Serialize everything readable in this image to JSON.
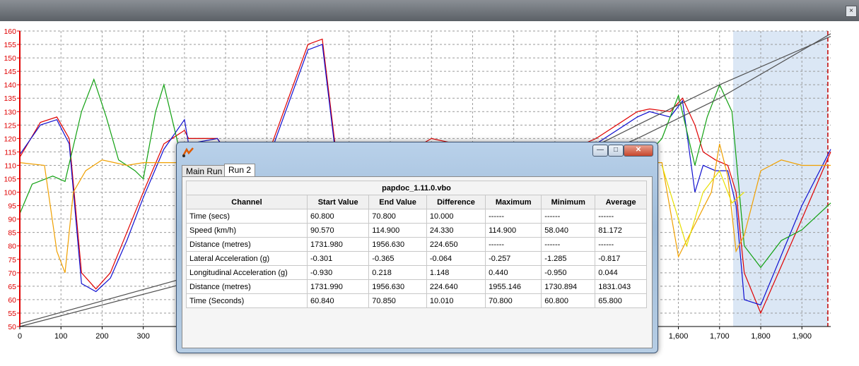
{
  "window": {
    "title_icon": "dataplot-icon",
    "buttons": {
      "minimize": "—",
      "maximize": "□",
      "close": "✕"
    },
    "close_top": "×"
  },
  "tabs": [
    {
      "label": "Main Run",
      "active": false
    },
    {
      "label": "Run 2",
      "active": true
    }
  ],
  "table": {
    "title": "papdoc_1.11.0.vbo",
    "headers": [
      "Channel",
      "Start Value",
      "End Value",
      "Difference",
      "Maximum",
      "Minimum",
      "Average"
    ],
    "rows": [
      [
        "Time (secs)",
        "60.800",
        "70.800",
        "10.000",
        "------",
        "------",
        "------"
      ],
      [
        "Speed (km/h)",
        "90.570",
        "114.900",
        "24.330",
        "114.900",
        "58.040",
        "81.172"
      ],
      [
        "Distance (metres)",
        "1731.980",
        "1956.630",
        "224.650",
        "------",
        "------",
        "------"
      ],
      [
        "Lateral Acceleration (g)",
        "-0.301",
        "-0.365",
        "-0.064",
        "-0.257",
        "-1.285",
        "-0.817"
      ],
      [
        "Longitudinal Acceleration (g)",
        "-0.930",
        "0.218",
        "1.148",
        "0.440",
        "-0.950",
        "0.044"
      ],
      [
        "Distance (metres)",
        "1731.990",
        "1956.630",
        "224.640",
        "1955.146",
        "1730.894",
        "1831.043"
      ],
      [
        "Time (Seconds)",
        "60.840",
        "70.850",
        "10.010",
        "70.800",
        "60.800",
        "65.800"
      ]
    ]
  },
  "chart_data": {
    "type": "line",
    "xlim": [
      0,
      1970
    ],
    "ylim": [
      50,
      160
    ],
    "x_ticks": [
      "0",
      "100",
      "200",
      "300",
      "1,600",
      "1,700",
      "1,800",
      "1,900"
    ],
    "x_tick_values": [
      0,
      100,
      200,
      300,
      1600,
      1700,
      1800,
      1900
    ],
    "y_ticks": [
      "50",
      "55",
      "60",
      "65",
      "70",
      "75",
      "80",
      "85",
      "90",
      "95",
      "100",
      "105",
      "110",
      "115",
      "120",
      "125",
      "130",
      "135",
      "140",
      "145",
      "150",
      "155",
      "160"
    ],
    "grid": true,
    "selection_x": [
      1733,
      1963
    ],
    "colors": {
      "red": "#e00000",
      "blue": "#1010d0",
      "green": "#10a010",
      "orange": "#f0a000",
      "yellow": "#e8e000",
      "gray": "#505050",
      "axis": "#e00000",
      "selection": "#dbe7f5"
    },
    "series": [
      {
        "color": "#e00000",
        "x": [
          0,
          50,
          90,
          120,
          150,
          185,
          220,
          260,
          300,
          350,
          400,
          410,
          480,
          570,
          700,
          735,
          780,
          1000,
          1150,
          1250,
          1400,
          1500,
          1530,
          1580,
          1610,
          1640,
          1660,
          1690,
          1720,
          1740,
          1760,
          1800,
          1900,
          1970
        ],
        "y": [
          113,
          126,
          128,
          120,
          70,
          64,
          70,
          85,
          100,
          118,
          123,
          120,
          120,
          100,
          155,
          157,
          100,
          120,
          115,
          110,
          120,
          130,
          131,
          130,
          135,
          125,
          115,
          112,
          110,
          100,
          70,
          55,
          90,
          115
        ]
      },
      {
        "color": "#1010d0",
        "x": [
          0,
          50,
          90,
          120,
          150,
          185,
          220,
          260,
          300,
          350,
          400,
          410,
          480,
          570,
          700,
          735,
          780,
          1000,
          1150,
          1250,
          1400,
          1500,
          1530,
          1580,
          1610,
          1640,
          1660,
          1690,
          1720,
          1740,
          1760,
          1800,
          1900,
          1970
        ],
        "y": [
          114,
          125,
          127,
          118,
          66,
          63,
          68,
          82,
          98,
          116,
          127,
          118,
          120,
          98,
          153,
          155,
          98,
          118,
          113,
          108,
          118,
          128,
          130,
          128,
          134,
          100,
          110,
          108,
          108,
          95,
          60,
          58,
          95,
          116
        ]
      },
      {
        "color": "#10a010",
        "x": [
          0,
          30,
          80,
          110,
          150,
          180,
          210,
          240,
          280,
          300,
          330,
          350,
          400,
          450,
          1000,
          1500,
          1560,
          1600,
          1640,
          1670,
          1700,
          1730,
          1760,
          1800,
          1850,
          1900,
          1970
        ],
        "y": [
          92,
          103,
          106,
          104,
          130,
          142,
          128,
          112,
          108,
          105,
          130,
          140,
          108,
          110,
          112,
          110,
          120,
          136,
          110,
          128,
          140,
          130,
          80,
          72,
          82,
          86,
          96
        ]
      },
      {
        "color": "#f0a000",
        "x": [
          0,
          60,
          90,
          110,
          130,
          160,
          200,
          260,
          300,
          350,
          400,
          1560,
          1600,
          1620,
          1680,
          1700,
          1720,
          1740,
          1760,
          1800,
          1850,
          1900,
          1970
        ],
        "y": [
          111,
          110,
          78,
          70,
          100,
          108,
          112,
          110,
          111,
          111,
          111,
          111,
          76,
          82,
          100,
          118,
          106,
          78,
          84,
          108,
          112,
          110,
          110
        ]
      },
      {
        "color": "#e8e000",
        "x": [
          1560,
          1600,
          1620,
          1660,
          1700,
          1730,
          1760
        ],
        "y": [
          110,
          90,
          80,
          100,
          108,
          96,
          100
        ]
      },
      {
        "color": "#505050",
        "x": [
          0,
          400,
          800,
          1200,
          1500,
          1700,
          1970
        ],
        "y": [
          51,
          68,
          85,
          102,
          125,
          140,
          158
        ]
      },
      {
        "color": "#505050",
        "x": [
          0,
          400,
          800,
          1200,
          1500,
          1700,
          1970
        ],
        "y": [
          50,
          66,
          83,
          100,
          120,
          135,
          159
        ]
      }
    ]
  }
}
